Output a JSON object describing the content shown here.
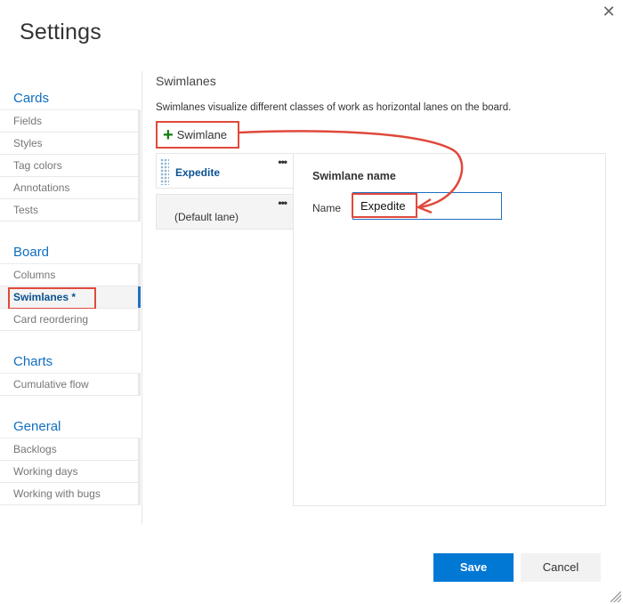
{
  "dialog": {
    "title": "Settings",
    "close_icon": "close-icon"
  },
  "sidebar": {
    "groups": [
      {
        "title": "Cards",
        "items": [
          {
            "label": "Fields"
          },
          {
            "label": "Styles"
          },
          {
            "label": "Tag colors"
          },
          {
            "label": "Annotations"
          },
          {
            "label": "Tests"
          }
        ]
      },
      {
        "title": "Board",
        "items": [
          {
            "label": "Columns"
          },
          {
            "label": "Swimlanes *",
            "selected": true
          },
          {
            "label": "Card reordering"
          }
        ]
      },
      {
        "title": "Charts",
        "items": [
          {
            "label": "Cumulative flow"
          }
        ]
      },
      {
        "title": "General",
        "items": [
          {
            "label": "Backlogs"
          },
          {
            "label": "Working days"
          },
          {
            "label": "Working with bugs"
          }
        ]
      }
    ]
  },
  "main": {
    "section_title": "Swimlanes",
    "description": "Swimlanes visualize different classes of work as horizontal lanes on the board.",
    "add_button": {
      "icon": "plus-icon",
      "label": "Swimlane"
    },
    "lanes": [
      {
        "name": "Expedite",
        "more_label": "•••",
        "active": true
      },
      {
        "name": "(Default lane)",
        "more_label": "•••",
        "active": false
      }
    ],
    "detail": {
      "header": "Swimlane name",
      "name_label": "Name",
      "name_value": "Expedite"
    }
  },
  "footer": {
    "save_label": "Save",
    "cancel_label": "Cancel"
  },
  "colors": {
    "accent": "#0078d4",
    "highlight": "#e0493b",
    "add_icon": "#107c10",
    "nav_title": "#106ebe"
  }
}
